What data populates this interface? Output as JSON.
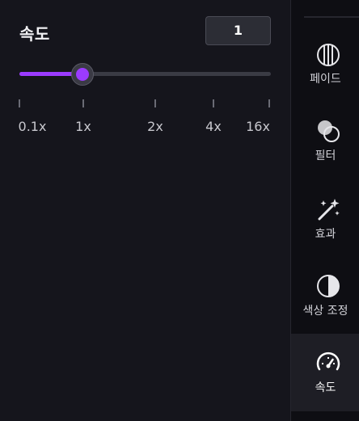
{
  "speed_panel": {
    "title": "속도",
    "value": "1",
    "slider": {
      "min": "0.1x",
      "max": "16x",
      "current": "1x",
      "fill_fraction": 0.25
    },
    "ticks": [
      "0.1x",
      "1x",
      "2x",
      "4x",
      "16x"
    ]
  },
  "rail": {
    "items": [
      {
        "label": "페이드",
        "icon": "fade-icon"
      },
      {
        "label": "필터",
        "icon": "filter-icon"
      },
      {
        "label": "효과",
        "icon": "magic-wand-icon"
      },
      {
        "label": "색상 조정",
        "icon": "contrast-icon"
      },
      {
        "label": "속도",
        "icon": "speedometer-icon",
        "active": true
      }
    ]
  },
  "colors": {
    "accent": "#9b3bff",
    "panel_bg": "#15151c",
    "rail_bg": "#0e0e13",
    "active_item_bg": "#1e1e25"
  }
}
